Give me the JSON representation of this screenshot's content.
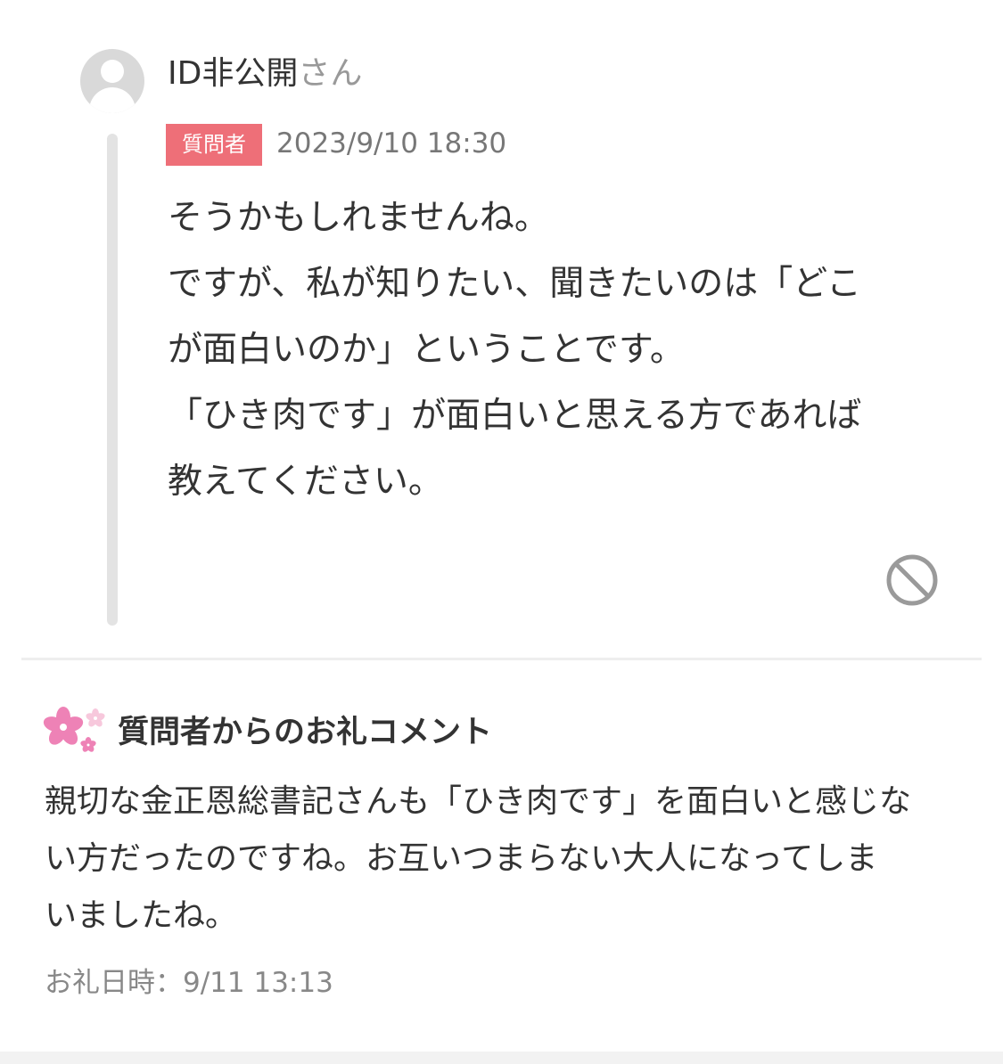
{
  "reply": {
    "user_name": "ID非公開",
    "user_suffix": "さん",
    "badge": "質問者",
    "timestamp": "2023/9/10 18:30",
    "body_lines": [
      "そうかもしれませんね。",
      "ですが、私が知りたい、聞きたいのは「どこ",
      "が面白いのか」ということです。",
      "「ひき肉です」が面白いと思える方であれば",
      "教えてください。"
    ],
    "block_icon": "block-icon"
  },
  "thanks": {
    "icon": "sakura-icon",
    "heading": "質問者からのお礼コメント",
    "body_lines": [
      "親切な金正恩総書記さんも「ひき肉です」を面白いと感じな",
      "い方だったのですね。お互いつまらない大人になってしま",
      "いましたね。"
    ],
    "date": "お礼日時：9/11 13:13"
  },
  "colors": {
    "badge": "#ee6f78",
    "thread_line": "#e3e3e3",
    "avatar": "#d9d9d9",
    "sakura_large": "#ee82b6",
    "sakura_small": "#f7c8dc"
  }
}
